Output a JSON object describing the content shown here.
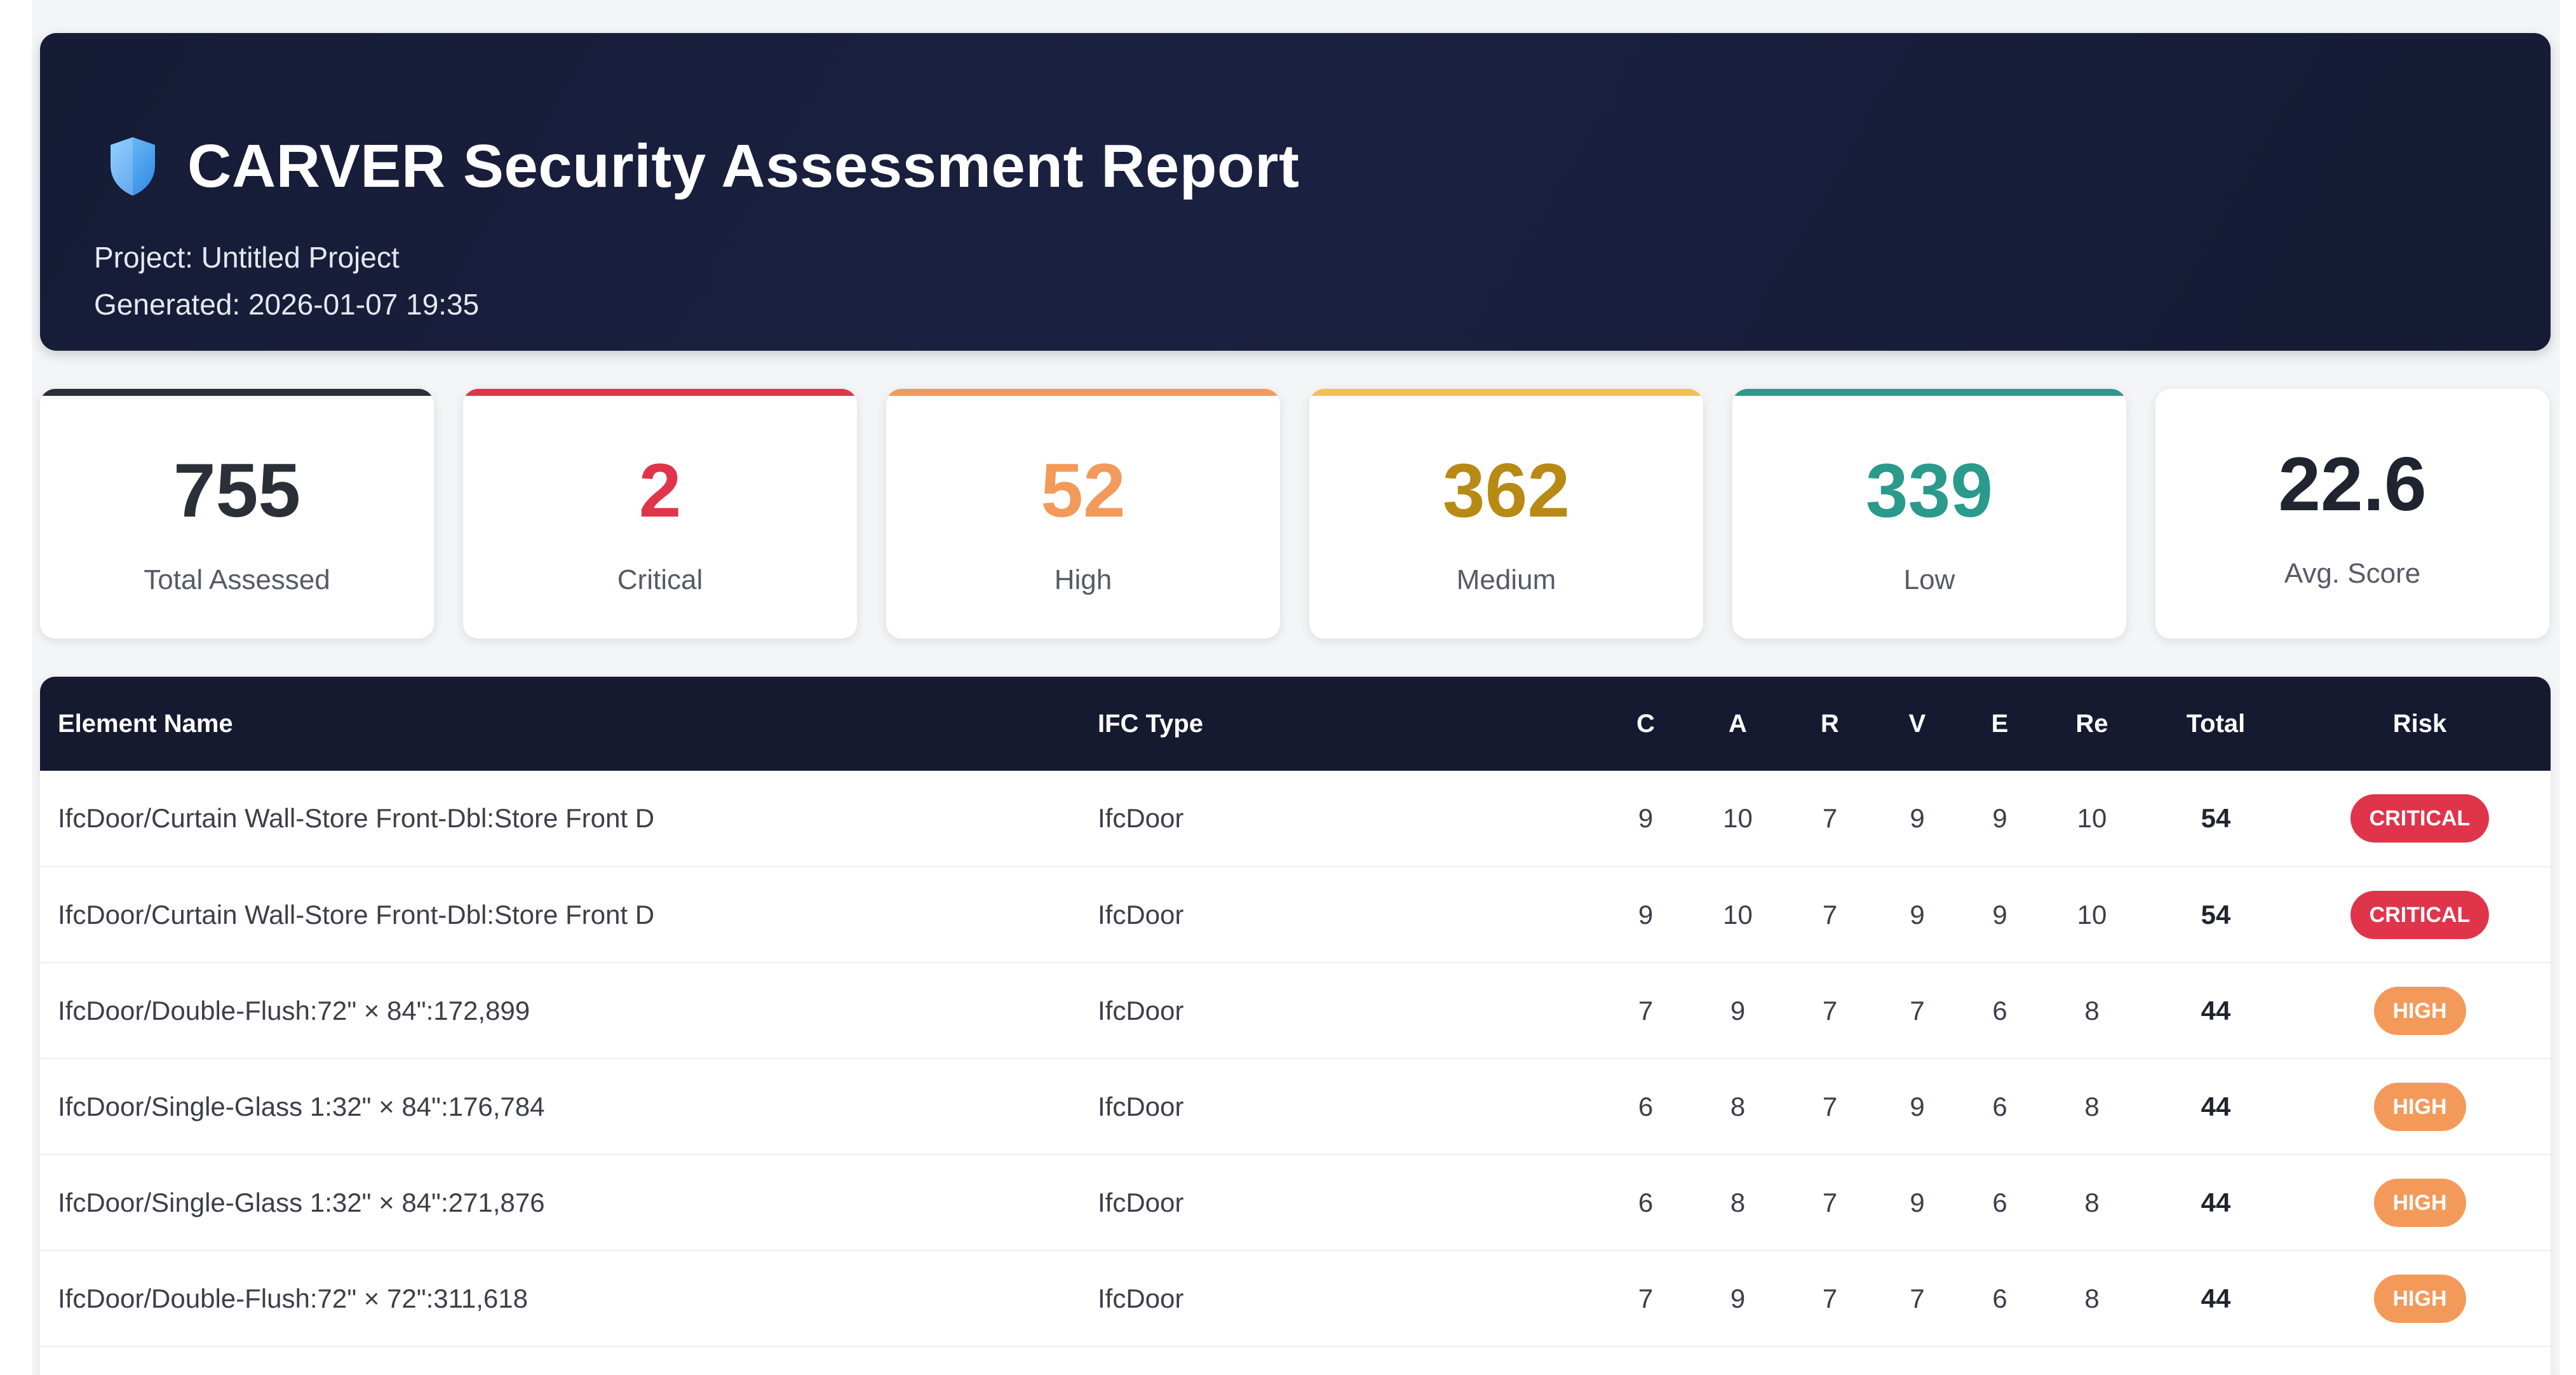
{
  "header": {
    "title": "CARVER Security Assessment Report",
    "project": "Project: Untitled Project",
    "generated": "Generated: 2026-01-07 19:35"
  },
  "summary": [
    {
      "value": "755",
      "label": "Total Assessed",
      "color": "#2b2f38",
      "bar": "#2b2f38"
    },
    {
      "value": "2",
      "label": "Critical",
      "color": "#e0344a",
      "bar": "#e0344a"
    },
    {
      "value": "52",
      "label": "High",
      "color": "#f39a5a",
      "bar": "#f39a5a"
    },
    {
      "value": "362",
      "label": "Medium",
      "color": "#b88a14",
      "bar": "#f0c050"
    },
    {
      "value": "339",
      "label": "Low",
      "color": "#2a9a8c",
      "bar": "#2a9a8c"
    },
    {
      "value": "22.6",
      "label": "Avg. Score",
      "color": "#1f2430",
      "bar": ""
    }
  ],
  "table": {
    "headers": {
      "name": "Element Name",
      "type": "IFC Type",
      "c": "C",
      "a": "A",
      "r": "R",
      "v": "V",
      "e": "E",
      "re": "Re",
      "total": "Total",
      "risk": "Risk"
    },
    "risk_colors": {
      "CRITICAL": "#e0344a",
      "HIGH": "#f39a5a"
    },
    "rows": [
      {
        "name": "IfcDoor/Curtain Wall-Store Front-Dbl:Store Front D",
        "type": "IfcDoor",
        "c": "9",
        "a": "10",
        "r": "7",
        "v": "9",
        "e": "9",
        "re": "10",
        "total": "54",
        "risk": "CRITICAL"
      },
      {
        "name": "IfcDoor/Curtain Wall-Store Front-Dbl:Store Front D",
        "type": "IfcDoor",
        "c": "9",
        "a": "10",
        "r": "7",
        "v": "9",
        "e": "9",
        "re": "10",
        "total": "54",
        "risk": "CRITICAL"
      },
      {
        "name": "IfcDoor/Double-Flush:72\" × 84\":172,899",
        "type": "IfcDoor",
        "c": "7",
        "a": "9",
        "r": "7",
        "v": "7",
        "e": "6",
        "re": "8",
        "total": "44",
        "risk": "HIGH"
      },
      {
        "name": "IfcDoor/Single-Glass 1:32\" × 84\":176,784",
        "type": "IfcDoor",
        "c": "6",
        "a": "8",
        "r": "7",
        "v": "9",
        "e": "6",
        "re": "8",
        "total": "44",
        "risk": "HIGH"
      },
      {
        "name": "IfcDoor/Single-Glass 1:32\" × 84\":271,876",
        "type": "IfcDoor",
        "c": "6",
        "a": "8",
        "r": "7",
        "v": "9",
        "e": "6",
        "re": "8",
        "total": "44",
        "risk": "HIGH"
      },
      {
        "name": "IfcDoor/Double-Flush:72\" × 72\":311,618",
        "type": "IfcDoor",
        "c": "7",
        "a": "9",
        "r": "7",
        "v": "7",
        "e": "6",
        "re": "8",
        "total": "44",
        "risk": "HIGH"
      }
    ]
  }
}
